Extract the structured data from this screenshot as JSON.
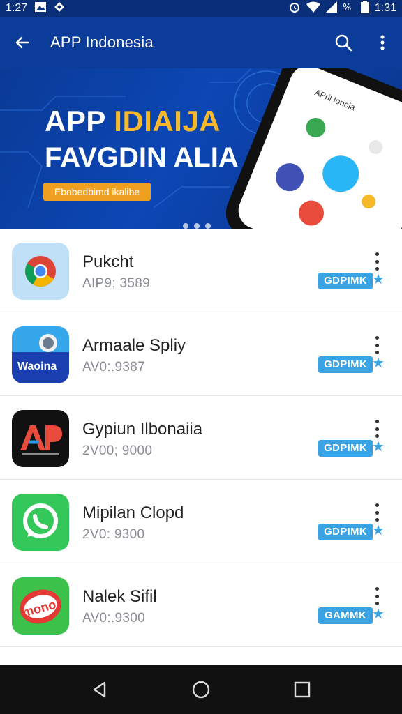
{
  "status_bar": {
    "time": "1:27",
    "right_time": "1:31"
  },
  "app_bar": {
    "title": "APP Indonesia"
  },
  "banner": {
    "line1_a": "APP ",
    "line1_b": "IDIAIJA",
    "line2": "FAVGDIN ALIA",
    "badge": "Ebobedbimd ikalibe",
    "phone_title": "APril Ionoia"
  },
  "apps": [
    {
      "name": "Pukcht",
      "sub": "AIP9; 3589",
      "tag": "GDPIMK"
    },
    {
      "name": "Armaale Spliy",
      "sub": "AV0:.9387",
      "tag": "GDPIMK"
    },
    {
      "name": "Gypiun Ilbonaiia",
      "sub": "2V00; 9000",
      "tag": "GDPIMK"
    },
    {
      "name": "Mipilan Clopd",
      "sub": "2V0: 9300",
      "tag": "GDPIMK"
    },
    {
      "name": "Nalek Sifil",
      "sub": "AV0:.9300",
      "tag": "GAMMK"
    }
  ],
  "colors": {
    "app_bar": "#0b3c9a",
    "accent": "#3aa3e3",
    "badge": "#f0a020"
  }
}
